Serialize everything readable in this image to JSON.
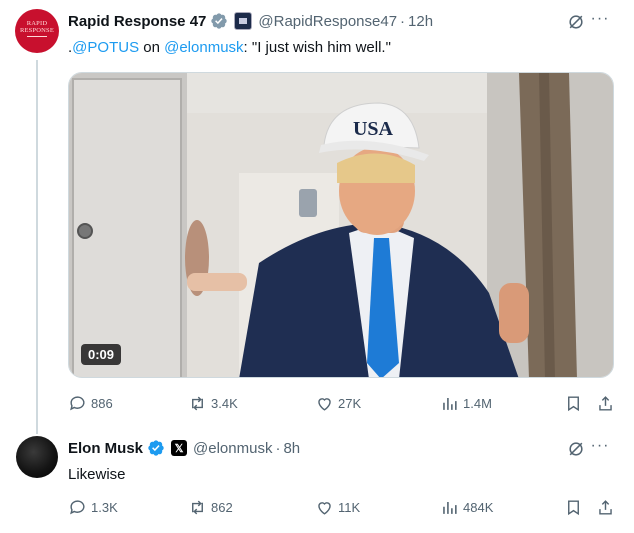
{
  "tweet1": {
    "avatar_text": [
      "RAPID",
      "RESPONSE"
    ],
    "name": "Rapid Response 47",
    "handle": "@RapidResponse47",
    "time": "12h",
    "text_prefix": ".",
    "mention1": "@POTUS",
    "text_mid": " on ",
    "mention2": "@elonmusk",
    "text_rest": ": \"I just wish him well.\"",
    "video": {
      "duration": "0:09",
      "cap_text": "USA"
    },
    "stats": {
      "replies": "886",
      "reposts": "3.4K",
      "likes": "27K",
      "views": "1.4M"
    }
  },
  "tweet2": {
    "name": "Elon Musk",
    "affiliate": "𝕏",
    "handle": "@elonmusk",
    "time": "8h",
    "text": "Likewise",
    "stats": {
      "replies": "1.3K",
      "reposts": "862",
      "likes": "11K",
      "views": "484K"
    }
  },
  "ui": {
    "dot": "·",
    "more": "···"
  },
  "colors": {
    "accent": "#1d9bf0",
    "muted": "#536471",
    "verified": "#1d9bf0",
    "gold_check": "#e2b719"
  },
  "icons": [
    "grok-icon",
    "more-icon",
    "reply-icon",
    "repost-icon",
    "like-icon",
    "views-icon",
    "bookmark-icon",
    "share-icon",
    "verified-icon",
    "affiliate-icon"
  ]
}
